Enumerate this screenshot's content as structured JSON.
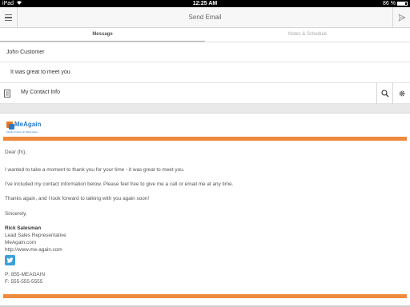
{
  "status_bar": {
    "carrier": "iPad",
    "time": "12:25 AM",
    "battery": "86 %",
    "battery_level": 0.86
  },
  "nav": {
    "title": "Send Email",
    "menu_icon": "hamburger-menu-icon",
    "send_icon": "paper-plane-icon"
  },
  "tabs": [
    {
      "label": "Message",
      "active": true
    },
    {
      "label": "Notes & Schedule",
      "active": false
    }
  ],
  "fields": {
    "to_value": "John Customer",
    "subject_value": "It was great to meet you",
    "template_label": "My Contact Info"
  },
  "email": {
    "logo_text": "MeAgain",
    "logo_tagline": "Mobile Follow-Up Made Easy",
    "accent_color": "#ee8a3c",
    "greeting": "Dear {fn},",
    "para1": "I wanted to take a moment to thank you for your time - it was great to meet you.",
    "para2": "I've included my contact information below. Please feel free to give me a call or email me at any time.",
    "para3": "Thanks again, and I look forward to talking with you again soon!",
    "closing": "Sincerely,",
    "signature": {
      "name": "Rick Salesman",
      "title": "Lead Sales Representative",
      "company": "MeAgain.com",
      "url": "http://www.me-again.com",
      "phone": "P: 855-MEAGAIN",
      "fax": "F: 555-555-5555"
    }
  }
}
